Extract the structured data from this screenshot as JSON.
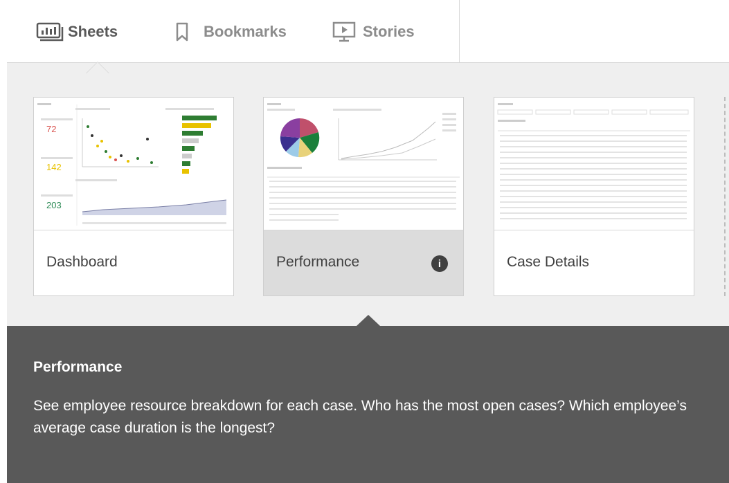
{
  "tabs": [
    {
      "label": "Sheets",
      "icon": "sheets-icon",
      "active": true
    },
    {
      "label": "Bookmarks",
      "icon": "bookmark-icon",
      "active": false
    },
    {
      "label": "Stories",
      "icon": "stories-icon",
      "active": false
    }
  ],
  "sheets": [
    {
      "title": "Dashboard",
      "kpis": [
        "72",
        "142",
        "203"
      ],
      "kpi_colors": [
        "#d9534f",
        "#e8c200",
        "#2e8b57"
      ]
    },
    {
      "title": "Performance",
      "has_info": true,
      "selected": true
    },
    {
      "title": "Case Details"
    }
  ],
  "tooltip": {
    "title": "Performance",
    "description": "See employee resource breakdown for each case. Who has the most open cases? Which employee’s average case duration is the longest?"
  },
  "colors": {
    "tooltip_bg": "#595959",
    "grid_bg": "#efefef",
    "selected_card_bg": "#dcdcdc"
  }
}
